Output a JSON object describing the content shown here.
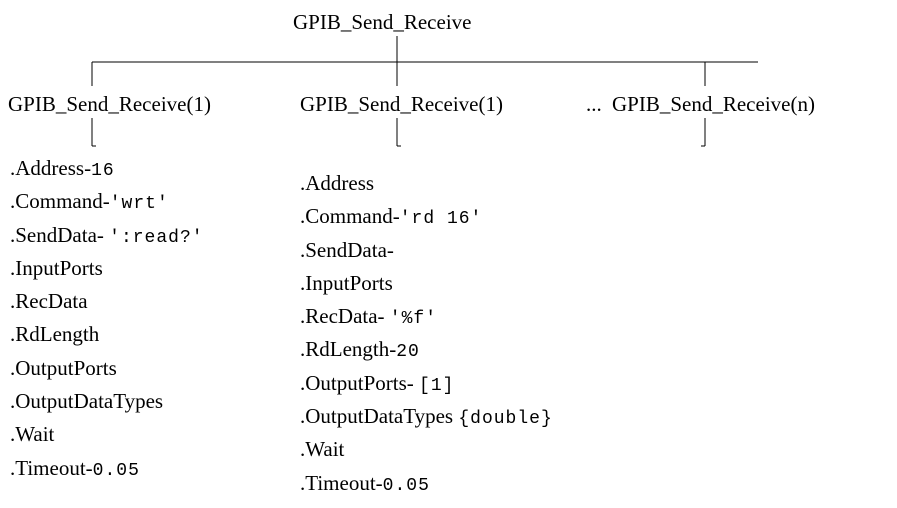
{
  "root": {
    "label": "GPIB_Send_Receive"
  },
  "children": [
    {
      "label": "GPIB_Send_Receive(1)"
    },
    {
      "label": "GPIB_Send_Receive(1)"
    },
    {
      "label": "GPIB_Send_Receive(n)"
    }
  ],
  "ellipsis": "...",
  "column1": {
    "fields": [
      {
        "name": ".Address",
        "sep": "-",
        "value": "16"
      },
      {
        "name": ".Command",
        "sep": "-",
        "value": "'wrt'"
      },
      {
        "name": ".SendData",
        "sep": "- ",
        "value": "':read?'"
      },
      {
        "name": ".InputPorts",
        "sep": "",
        "value": ""
      },
      {
        "name": ".RecData",
        "sep": "",
        "value": ""
      },
      {
        "name": ".RdLength",
        "sep": "",
        "value": ""
      },
      {
        "name": ".OutputPorts",
        "sep": "",
        "value": ""
      },
      {
        "name": ".OutputDataTypes",
        "sep": "",
        "value": ""
      },
      {
        "name": ".Wait",
        "sep": "",
        "value": ""
      },
      {
        "name": ".Timeout",
        "sep": "-",
        "value": "0.05"
      }
    ]
  },
  "column2": {
    "fields": [
      {
        "name": ".Address",
        "sep": "",
        "value": ""
      },
      {
        "name": ".Command",
        "sep": "-",
        "value": "'rd 16'"
      },
      {
        "name": ".SendData",
        "sep": "-",
        "value": ""
      },
      {
        "name": ".InputPorts",
        "sep": "",
        "value": ""
      },
      {
        "name": ".RecData",
        "sep": "- ",
        "value": "'%f'"
      },
      {
        "name": ".RdLength",
        "sep": "-",
        "value": "20"
      },
      {
        "name": ".OutputPorts",
        "sep": "- ",
        "value": "[1]"
      },
      {
        "name": ".OutputDataTypes",
        "sep": " ",
        "value": "{double}"
      },
      {
        "name": ".Wait",
        "sep": "",
        "value": ""
      },
      {
        "name": ".Timeout",
        "sep": "-",
        "value": "0.05"
      }
    ]
  }
}
